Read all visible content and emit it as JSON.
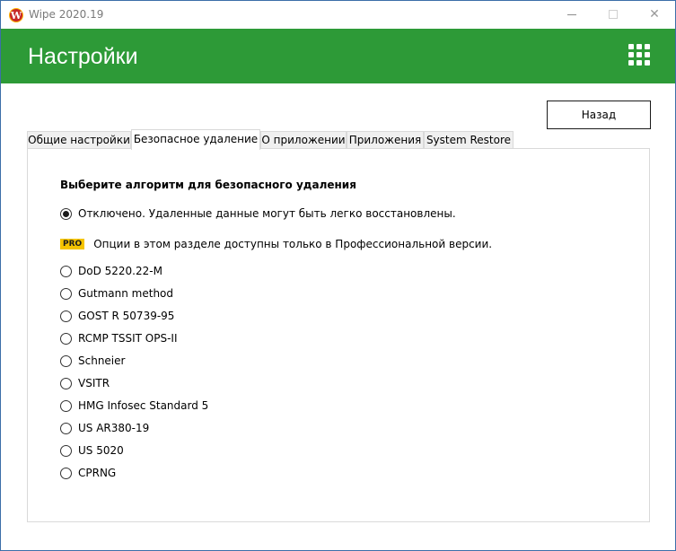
{
  "window": {
    "title": "Wipe 2020.19",
    "app_icon_letter": "W"
  },
  "header": {
    "title": "Настройки",
    "menu_icon": "grid-icon"
  },
  "back_button": {
    "label": "Назад"
  },
  "tabs": [
    {
      "label": "Общие настройки",
      "active": false
    },
    {
      "label": "Безопасное удаление",
      "active": true
    },
    {
      "label": "О приложении",
      "active": false
    },
    {
      "label": "Приложения",
      "active": false
    },
    {
      "label": "System Restore",
      "active": false
    }
  ],
  "panel": {
    "heading": "Выберите алгоритм для безопасного удаления",
    "disabled_option": {
      "label": "Отключено. Удаленные данные могут быть легко восстановлены.",
      "checked": true
    },
    "pro_notice": {
      "badge": "PRO",
      "text": "Опции в этом разделе доступны только в Профессиональной версии."
    },
    "algorithms": [
      "DoD 5220.22-M",
      "Gutmann method",
      "GOST R 50739-95",
      "RCMP TSSIT OPS-II",
      "Schneier",
      "VSITR",
      "HMG Infosec Standard 5",
      "US AR380-19",
      "US 5020",
      "CPRNG"
    ]
  },
  "colors": {
    "header_green": "#2d9a37",
    "pro_badge": "#f5c400"
  }
}
